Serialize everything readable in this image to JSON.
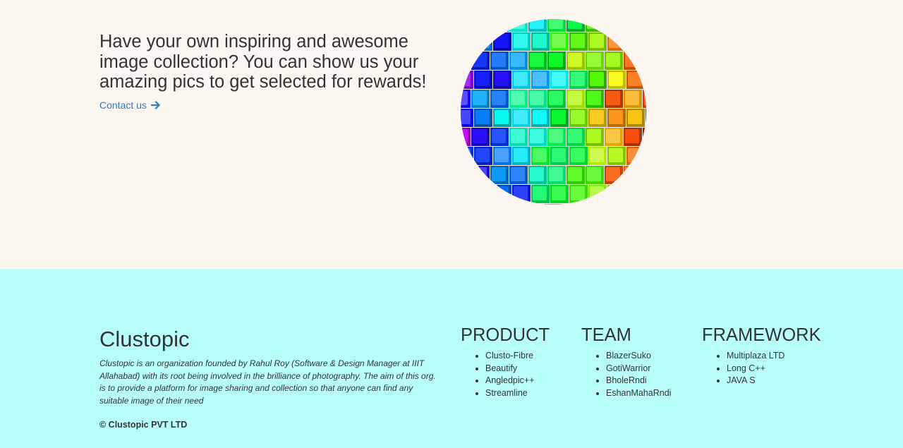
{
  "hero": {
    "heading": "Have your own inspiring and awesome image collection? You can show us your amazing pics to get selected for rewards!",
    "contact_label": "Contact us",
    "link_color": "#337ab7",
    "background": "#fcf6f0",
    "image_icon": "rainbow-cubes-image"
  },
  "footer": {
    "background": "#b8fffa",
    "brand": "Clustopic",
    "about": "Clustopic is an organization founded by Rahul Roy (Software & Design Manager at IIIT Allahabad) with its root being involved in the brilliance of photography. The aim of this org. is to provide a platform for image sharing and collection so that anyone can find any suitable image of their need",
    "copyright": "© Clustopic PVT LTD",
    "columns": [
      {
        "title": "PRODUCT",
        "items": [
          "Clusto-Fibre",
          "Beautify",
          "Angledpic++",
          "Streamline"
        ]
      },
      {
        "title": "TEAM",
        "items": [
          "BlazerSuko",
          "GotiWarrior",
          "BholeRndi",
          "EshanMahaRndi"
        ]
      },
      {
        "title": "FRAMEWORK",
        "items": [
          "Multiplaza LTD",
          "Long C++",
          "JAVA S"
        ]
      }
    ]
  }
}
